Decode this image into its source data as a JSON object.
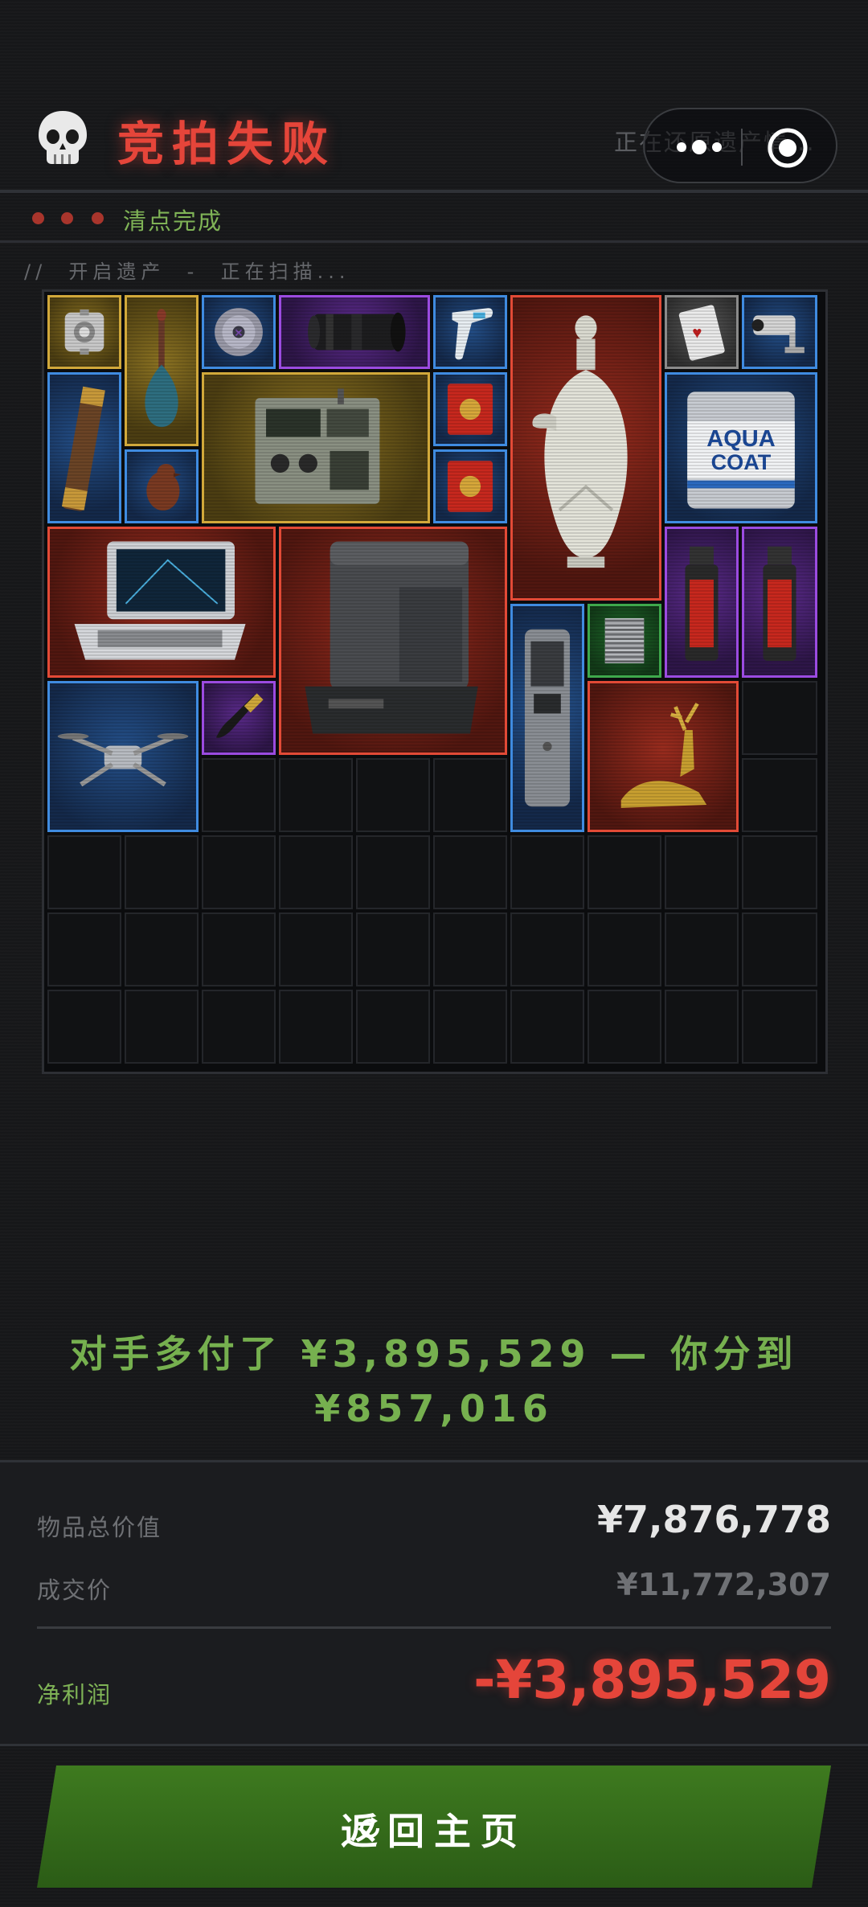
{
  "header": {
    "title": "竞拍失败",
    "restoring_text": "正在还原遗产情...",
    "skull_icon": "skull-icon",
    "capsule": {
      "more_icon": "more-dots-icon",
      "close_icon": "target-circle-icon"
    }
  },
  "status": {
    "done_text": "清点完成"
  },
  "scan_text": "//  开启遗产  -  正在扫描...",
  "inventory": {
    "columns": 10,
    "rows": 10,
    "items": [
      {
        "name": "companion-cube",
        "rarity": "gold"
      },
      {
        "name": "glass-decanter",
        "rarity": "gold"
      },
      {
        "name": "cd-disc",
        "rarity": "blue"
      },
      {
        "name": "camera-lens",
        "rarity": "purple"
      },
      {
        "name": "ir-thermometer",
        "rarity": "blue"
      },
      {
        "name": "celadon-ewer",
        "rarity": "red"
      },
      {
        "name": "playing-card",
        "rarity": "gray"
      },
      {
        "name": "security-camera",
        "rarity": "blue"
      },
      {
        "name": "brass-telescope",
        "rarity": "blue"
      },
      {
        "name": "military-radio",
        "rarity": "gold"
      },
      {
        "name": "red-tea-tin",
        "rarity": "blue"
      },
      {
        "name": "red-tea-tin",
        "rarity": "blue"
      },
      {
        "name": "paint-bucket",
        "rarity": "blue"
      },
      {
        "name": "wooden-bird",
        "rarity": "blue"
      },
      {
        "name": "rugged-laptop",
        "rarity": "red"
      },
      {
        "name": "robot-vacuum-station",
        "rarity": "red"
      },
      {
        "name": "gas-canister",
        "rarity": "purple"
      },
      {
        "name": "gas-canister",
        "rarity": "purple"
      },
      {
        "name": "power-bank",
        "rarity": "blue"
      },
      {
        "name": "cpu-cooler",
        "rarity": "green"
      },
      {
        "name": "drone",
        "rarity": "blue"
      },
      {
        "name": "ornate-dagger",
        "rarity": "purple"
      },
      {
        "name": "golden-deer",
        "rarity": "red"
      }
    ],
    "item_texts": {
      "paint_brand_1": "AQUA",
      "paint_brand_2": "COAT"
    }
  },
  "message": {
    "line1": "对手多付了 ¥3,895,529 — 你分到",
    "line2": "¥857,016"
  },
  "summary": {
    "total_value_label": "物品总价值",
    "total_value": "¥7,876,778",
    "deal_price_label": "成交价",
    "deal_price": "¥11,772,307",
    "net_profit_label": "净利润",
    "net_profit": "-¥3,895,529"
  },
  "colors": {
    "fail_red": "#e5453a",
    "profit_green": "#76b04f",
    "button_green": "#3e7a1f"
  },
  "return_button": {
    "label": "返回主页",
    "icon": "refresh-icon"
  }
}
